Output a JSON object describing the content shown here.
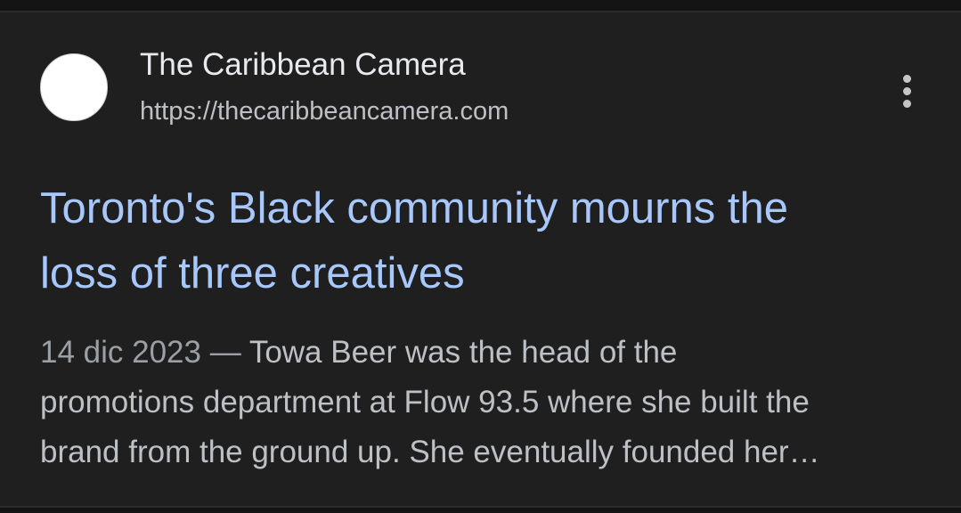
{
  "result": {
    "source_name": "The Caribbean Camera",
    "source_url": "https://thecaribbeancamera.com",
    "title_line1": "Toronto's Black community mourns the",
    "title_line2": "loss of three creatives",
    "date": "14 dic 2023",
    "separator": " — ",
    "snippet_line1": "Towa Beer was the head of the",
    "snippet_line2": "promotions department at Flow 93.5 where she built the",
    "snippet_line3": "brand from the ground up. She eventually founded her…"
  },
  "icons": {
    "favicon": "site-favicon-icon",
    "more": "more-vert-icon"
  },
  "colors": {
    "background": "#1f1f1f",
    "title_link": "#a8c7fa",
    "primary_text": "#e8eaed",
    "secondary_text": "#bdc1c6",
    "date_text": "#9aa0a6"
  }
}
